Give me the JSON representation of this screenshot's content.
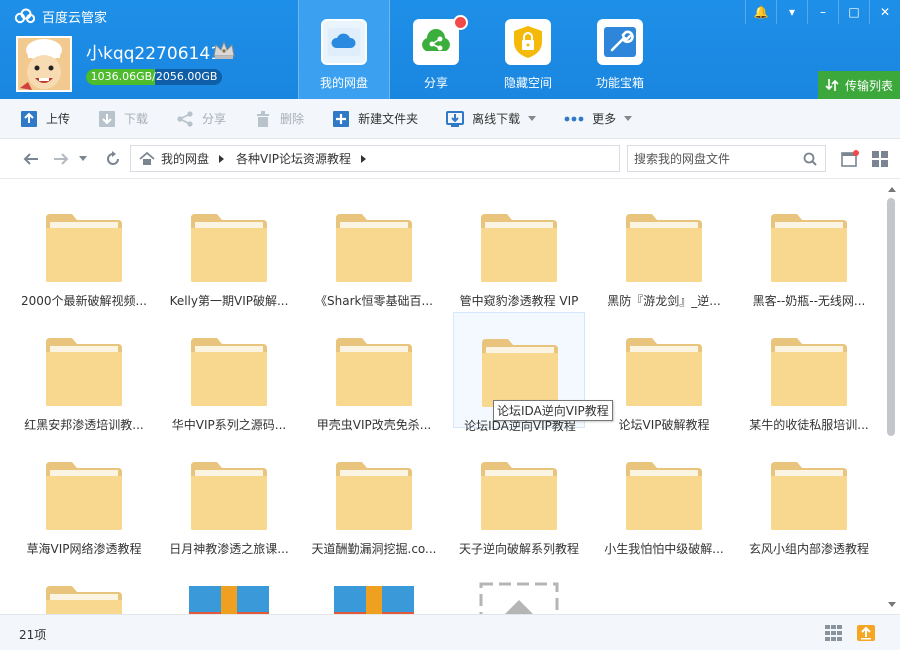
{
  "app": {
    "title": "百度云管家"
  },
  "user": {
    "name": "小kqq22706141",
    "quota_text": "1036.06GB/2056.00GB",
    "quota_used_fraction": 0.504
  },
  "nav": {
    "tabs": [
      {
        "label": "我的网盘",
        "icon": "cloud-drive-icon",
        "active": true
      },
      {
        "label": "分享",
        "icon": "share-icon",
        "badge": true
      },
      {
        "label": "隐藏空间",
        "icon": "lock-icon"
      },
      {
        "label": "功能宝箱",
        "icon": "toolbox-icon"
      }
    ]
  },
  "window_controls": {
    "notify": "🔔",
    "menu": "▾",
    "minimize": "–",
    "maximize": "□",
    "close": "✕"
  },
  "transfer_label": "传输列表",
  "toolbar": {
    "upload": "上传",
    "download": "下载",
    "share": "分享",
    "delete": "删除",
    "new_folder": "新建文件夹",
    "offline_download": "离线下载",
    "more": "更多"
  },
  "address": {
    "crumbs": [
      "我的网盘",
      "各种VIP论坛资源教程"
    ],
    "search_placeholder": "搜索我的网盘文件"
  },
  "files": [
    {
      "name": "2000个最新破解视频...",
      "type": "folder"
    },
    {
      "name": "Kelly第一期VIP破解...",
      "type": "folder"
    },
    {
      "name": "《Shark恒零基础百...",
      "type": "folder"
    },
    {
      "name": "管中窥豹渗透教程 VIP",
      "type": "folder"
    },
    {
      "name": "黑防『游龙剑』_逆...",
      "type": "folder"
    },
    {
      "name": "黑客--奶瓶--无线网...",
      "type": "folder"
    },
    {
      "name": "红黑安邦渗透培训教...",
      "type": "folder"
    },
    {
      "name": "华中VIP系列之源码...",
      "type": "folder"
    },
    {
      "name": "甲壳虫VIP改壳免杀...",
      "type": "folder"
    },
    {
      "name": "论坛IDA逆向VIP教程",
      "type": "folder",
      "hover": true
    },
    {
      "name": "论坛VIP破解教程",
      "type": "folder"
    },
    {
      "name": "某牛的收徒私服培训...",
      "type": "folder"
    },
    {
      "name": "草海VIP网络渗透教程",
      "type": "folder"
    },
    {
      "name": "日月神教渗透之旅课...",
      "type": "folder"
    },
    {
      "name": "天道酬勤漏洞挖掘.co...",
      "type": "folder"
    },
    {
      "name": "天子逆向破解系列教程",
      "type": "folder"
    },
    {
      "name": "小生我怕怕中级破解...",
      "type": "folder"
    },
    {
      "name": "玄风小组内部渗透教程",
      "type": "folder"
    },
    {
      "name": "",
      "type": "folder"
    },
    {
      "name": "",
      "type": "archive"
    },
    {
      "name": "",
      "type": "archive"
    },
    {
      "name": "",
      "type": "upload-placeholder"
    }
  ],
  "tooltip": "论坛IDA逆向VIP教程",
  "status": {
    "count": "21项"
  }
}
